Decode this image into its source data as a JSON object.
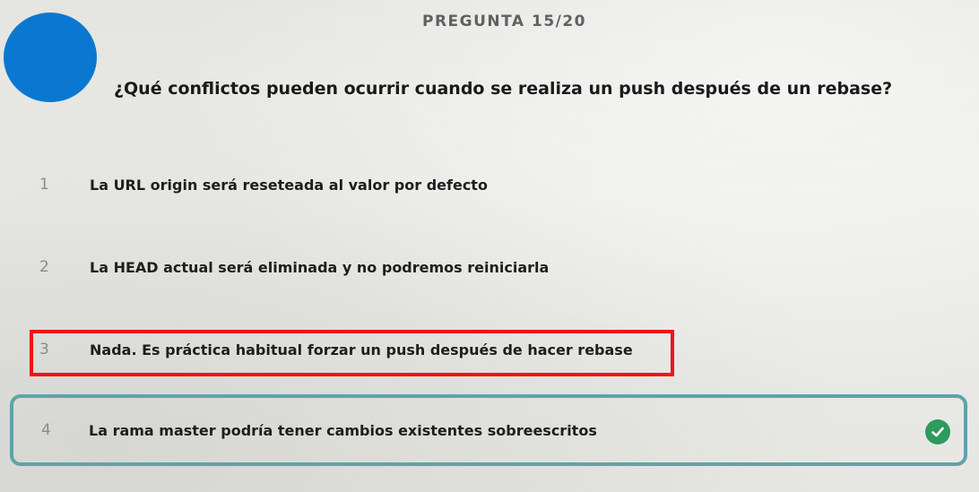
{
  "quiz": {
    "counter": "PREGUNTA 15/20",
    "question": "¿Qué conflictos pueden ocurrir cuando se realiza un push después de un rebase?"
  },
  "options": [
    {
      "number": "1",
      "text": "La URL origin será reseteada al valor por defecto"
    },
    {
      "number": "2",
      "text": "La HEAD actual será eliminada y no podremos reiniciarla"
    },
    {
      "number": "3",
      "text": "Nada. Es práctica habitual forzar un push después de hacer rebase"
    },
    {
      "number": "4",
      "text": "La rama master podría tener cambios existentes sobreescritos"
    }
  ],
  "state": {
    "selected_option": "4",
    "correct_indicator_icon": "check-circle-icon",
    "highlighted_option": "3"
  },
  "colors": {
    "avatar": "#0a78d0",
    "selected_border": "#5fa3a8",
    "highlight_box": "#f01414",
    "check": "#2e9a5c"
  }
}
